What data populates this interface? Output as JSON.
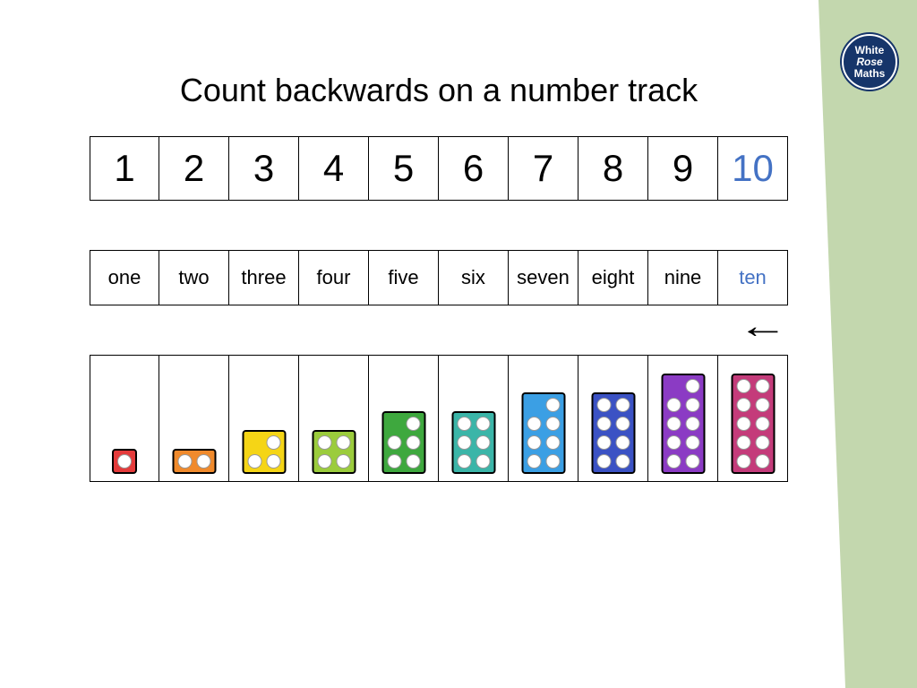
{
  "logo": {
    "line1": "White",
    "line2": "Rose",
    "line3": "Maths"
  },
  "title": "Count backwards on a number track",
  "numbers": [
    "1",
    "2",
    "3",
    "4",
    "5",
    "6",
    "7",
    "8",
    "9",
    "10"
  ],
  "words": [
    "one",
    "two",
    "three",
    "four",
    "five",
    "six",
    "seven",
    "eight",
    "nine",
    "ten"
  ],
  "highlightIndex": 9,
  "blocks": [
    {
      "color": "c1",
      "grid": "single",
      "dots": [
        1
      ]
    },
    {
      "color": "c2",
      "grid": "double",
      "dots": [
        1,
        1
      ]
    },
    {
      "color": "c3",
      "grid": "double",
      "dots": [
        0,
        1,
        1,
        1
      ]
    },
    {
      "color": "c4",
      "grid": "double",
      "dots": [
        1,
        1,
        1,
        1
      ]
    },
    {
      "color": "c5",
      "grid": "double",
      "dots": [
        0,
        1,
        1,
        1,
        1,
        1
      ]
    },
    {
      "color": "c6",
      "grid": "double",
      "dots": [
        1,
        1,
        1,
        1,
        1,
        1
      ]
    },
    {
      "color": "c7",
      "grid": "double",
      "dots": [
        0,
        1,
        1,
        1,
        1,
        1,
        1,
        1
      ]
    },
    {
      "color": "c8",
      "grid": "double",
      "dots": [
        1,
        1,
        1,
        1,
        1,
        1,
        1,
        1
      ]
    },
    {
      "color": "c9",
      "grid": "double",
      "dots": [
        0,
        1,
        1,
        1,
        1,
        1,
        1,
        1,
        1,
        1
      ]
    },
    {
      "color": "c10",
      "grid": "double",
      "dots": [
        1,
        1,
        1,
        1,
        1,
        1,
        1,
        1,
        1,
        1
      ]
    }
  ],
  "arrow": "←"
}
